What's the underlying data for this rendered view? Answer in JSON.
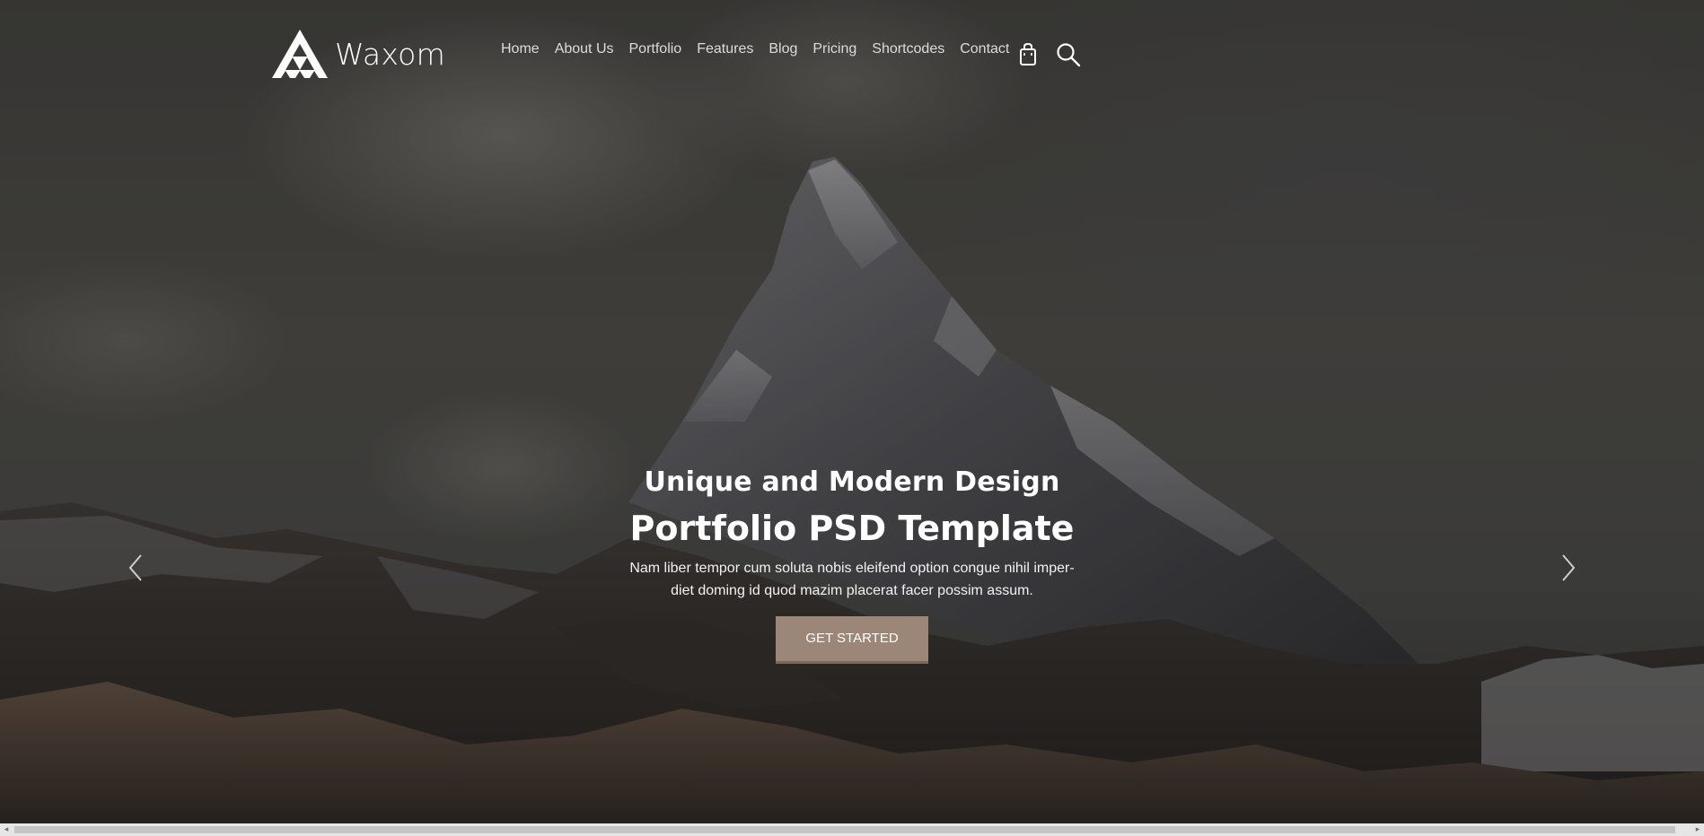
{
  "brand": {
    "name": "Waxom",
    "logo_icon": "triangle-logo-icon"
  },
  "nav": {
    "items": [
      {
        "label": "Home"
      },
      {
        "label": "About Us"
      },
      {
        "label": "Portfolio"
      },
      {
        "label": "Features"
      },
      {
        "label": "Blog"
      },
      {
        "label": "Pricing"
      },
      {
        "label": "Shortcodes"
      },
      {
        "label": "Contact"
      }
    ],
    "icons": [
      "shopping-bag-icon",
      "search-icon"
    ]
  },
  "hero": {
    "subtitle": "Unique and Modern Design",
    "title": "Portfolio PSD Template",
    "text": "Nam liber tempor cum soluta nobis eleifend option congue nihil imper-diet doming id quod mazim placerat facer possim assum.",
    "cta_label": "GET STARTED",
    "prev_icon": "chevron-left-icon",
    "next_icon": "chevron-right-icon"
  },
  "colors": {
    "accent": "#9b8677",
    "text": "#ffffff"
  },
  "scrollbar": {
    "left_arrow": "◂",
    "right_arrow": "▸"
  }
}
